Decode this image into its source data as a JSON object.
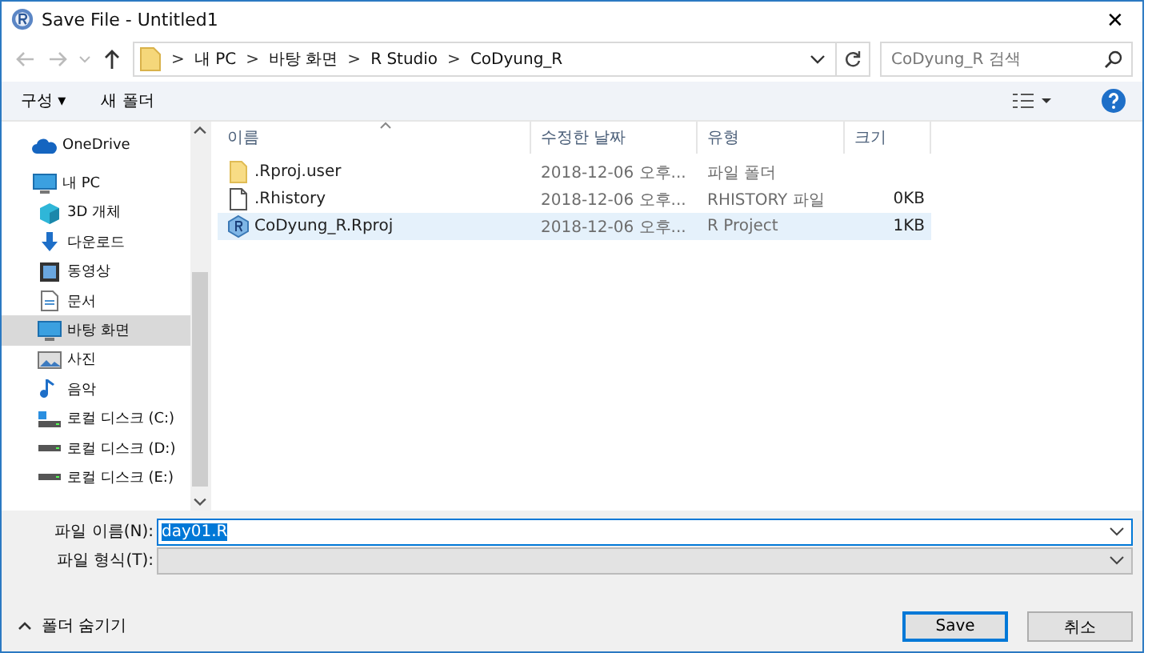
{
  "window": {
    "title": "Save File - Untitled1",
    "close": "✕"
  },
  "address": {
    "breadcrumb": [
      "내 PC",
      "바탕 화면",
      "R Studio",
      "CoDyung_R"
    ],
    "separator": ">"
  },
  "search": {
    "placeholder": "CoDyung_R 검색"
  },
  "toolbar": {
    "organize": "구성 ▾",
    "new_folder": "새 폴더"
  },
  "sidebar": {
    "items": [
      {
        "label": "OneDrive",
        "kind": "cloud",
        "selected": false
      },
      {
        "label": "내 PC",
        "kind": "pc",
        "selected": false,
        "children": [
          {
            "label": "3D 개체",
            "kind": "cube",
            "selected": false
          },
          {
            "label": "다운로드",
            "kind": "download",
            "selected": false
          },
          {
            "label": "동영상",
            "kind": "video",
            "selected": false
          },
          {
            "label": "문서",
            "kind": "document",
            "selected": false
          },
          {
            "label": "바탕 화면",
            "kind": "desktop",
            "selected": true
          },
          {
            "label": "사진",
            "kind": "photo",
            "selected": false
          },
          {
            "label": "음악",
            "kind": "music",
            "selected": false
          },
          {
            "label": "로컬 디스크 (C:)",
            "kind": "system-drive",
            "selected": false
          },
          {
            "label": "로컬 디스크 (D:)",
            "kind": "drive",
            "selected": false
          },
          {
            "label": "로컬 디스크 (E:)",
            "kind": "drive",
            "selected": false
          }
        ]
      }
    ]
  },
  "table": {
    "columns": [
      "이름",
      "수정한 날짜",
      "유형",
      "크기"
    ],
    "rows": [
      {
        "name": ".Rproj.user",
        "kind": "folder",
        "date": "2018-12-06 오후...",
        "type": "파일 폴더",
        "size": "",
        "selected": false
      },
      {
        "name": ".Rhistory",
        "kind": "file",
        "date": "2018-12-06 오후...",
        "type": "RHISTORY 파일",
        "size": "0KB",
        "selected": false
      },
      {
        "name": "CoDyung_R.Rproj",
        "kind": "project",
        "date": "2018-12-06 오후...",
        "type": "R Project",
        "size": "1KB",
        "selected": true
      }
    ]
  },
  "form": {
    "file_name_label": "파일 이름(N):",
    "file_name": "day01.R",
    "file_name_highlighted": true,
    "file_type_label": "파일 형식(T):"
  },
  "footer": {
    "hide_folders": "폴더 숨기기",
    "buttons": [
      {
        "label": "Save",
        "default": true
      },
      {
        "label": "취소",
        "default": false
      }
    ]
  }
}
